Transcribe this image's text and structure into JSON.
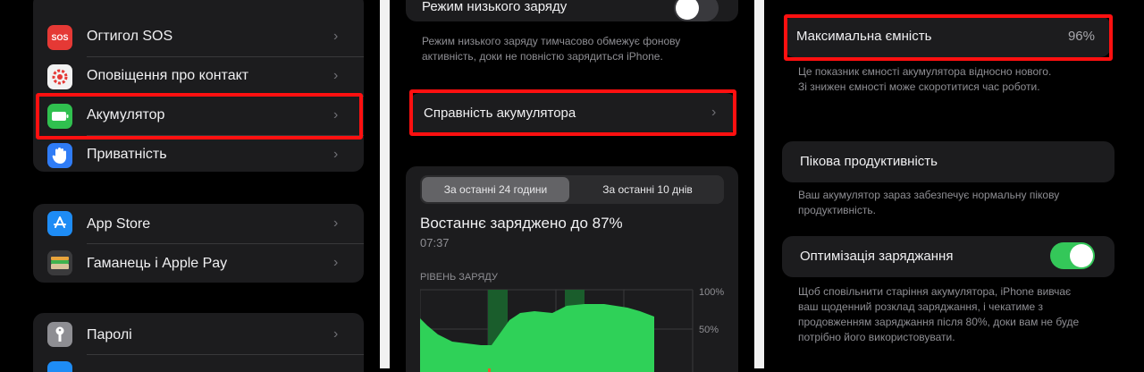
{
  "left": {
    "group1": {
      "items": [
        {
          "label": "Огтигол SOS",
          "icon": "sos-icon",
          "icon_text": "SOS",
          "icon_color": "#e53935"
        },
        {
          "label": "Оповіщення про контакт",
          "icon": "exposure-icon",
          "icon_color": "#f2f2f2"
        },
        {
          "label": "Акумулятор",
          "icon": "battery-icon",
          "icon_color": "#30c04f"
        },
        {
          "label": "Приватність",
          "icon": "hand-icon",
          "icon_color": "#2f7cf6"
        }
      ]
    },
    "group2": {
      "items": [
        {
          "label": "App Store",
          "icon": "app-store-icon",
          "icon_color": "#1e8cf5"
        },
        {
          "label": "Гаманець і Apple Pay",
          "icon": "wallet-icon",
          "icon_color": "#3a3a3c"
        }
      ]
    },
    "group3": {
      "items": [
        {
          "label": "Паролі",
          "icon": "key-icon",
          "icon_color": "#8e8e93"
        }
      ]
    }
  },
  "middle": {
    "top_toggle_label": "Режим низького заряду",
    "footer": "Режим низького заряду тимчасово обмежує фонову активність, доки не повністю зарядиться iPhone.",
    "health_row_label": "Справність акумулятора",
    "segments": [
      "За останні 24 години",
      "За останні 10 днів"
    ],
    "last_charged": "Востаннє заряджено до 87%",
    "last_charged_time": "07:37",
    "chart_label": "РІВЕНЬ ЗАРЯДУ",
    "chart_ticks": [
      "100%",
      "50%"
    ]
  },
  "right": {
    "capacity_label": "Максимальна ємність",
    "capacity_value": "96%",
    "capacity_footer": "Це показник ємності акумулятора відносно нового. Зі знижен ємності може скоротитися час роботи.",
    "peak_label": "Пікова продуктивність",
    "peak_footer": "Ваш акумулятор зараз забезпечує нормальну пікову продуктивність.",
    "optimize_label": "Оптимізація заряджання",
    "optimize_footer": "Щоб сповільнити старіння акумулятора, iPhone вивчає ваш щоденний розклад заряджання, і чекатиме з продовженням заряджання після 80%, доки вам не буде потрібно його використовувати."
  },
  "colors": {
    "highlight": "#ff1010",
    "toggle_on": "#34c759",
    "toggle_off": "#39393d",
    "chart_green": "#2fd158",
    "chart_dark_green": "#1a5d2c"
  }
}
